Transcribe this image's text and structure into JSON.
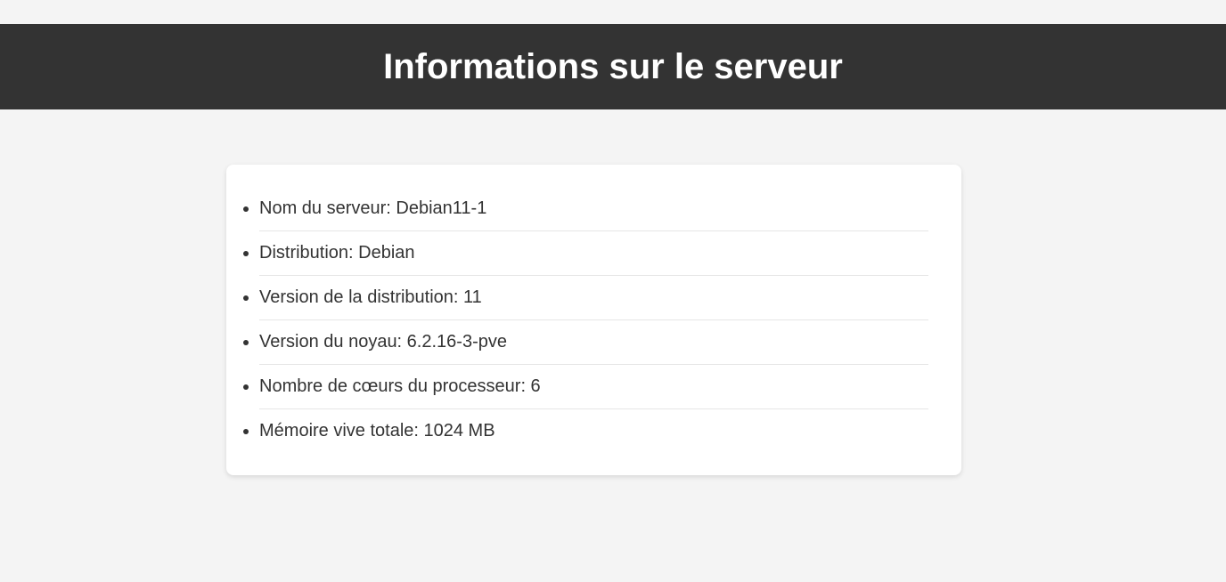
{
  "header": {
    "title": "Informations sur le serveur"
  },
  "info": {
    "items": [
      "Nom du serveur: Debian11-1",
      "Distribution: Debian",
      "Version de la distribution: 11",
      "Version du noyau: 6.2.16-3-pve",
      "Nombre de cœurs du processeur: 6",
      "Mémoire vive totale: 1024 MB"
    ]
  },
  "colors": {
    "header_bg": "#333333",
    "page_bg": "#f4f4f4",
    "card_bg": "#ffffff",
    "text": "#333333"
  }
}
